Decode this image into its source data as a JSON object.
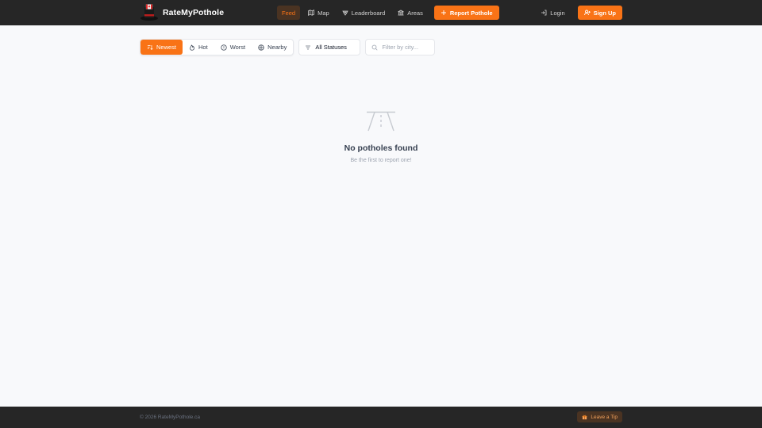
{
  "header": {
    "brand": "RateMyPothole",
    "nav": [
      {
        "label": "Feed",
        "icon": "none",
        "active": true
      },
      {
        "label": "Map",
        "icon": "map-icon"
      },
      {
        "label": "Leaderboard",
        "icon": "trophy-icon"
      },
      {
        "label": "Areas",
        "icon": "building-icon"
      }
    ],
    "report_label": "Report Pothole",
    "login_label": "Login",
    "signup_label": "Sign Up"
  },
  "filters": {
    "sort_tabs": [
      {
        "label": "Newest",
        "icon": "sort-icon",
        "active": true
      },
      {
        "label": "Hot",
        "icon": "flame-icon"
      },
      {
        "label": "Worst",
        "icon": "alert-circle-icon"
      },
      {
        "label": "Nearby",
        "icon": "crosshair-icon"
      }
    ],
    "status_value": "All Statuses",
    "city_placeholder": "Filter by city...",
    "city_value": ""
  },
  "empty_state": {
    "icon": "road-icon",
    "title": "No potholes found",
    "subtitle": "Be the first to report one!"
  },
  "footer": {
    "copyright": "© 2026 RateMyPothole.ca",
    "tip_label": "Leave a Tip"
  },
  "colors": {
    "accent": "#f97316",
    "header_bg": "#262626",
    "page_bg": "#f8f9fb"
  }
}
